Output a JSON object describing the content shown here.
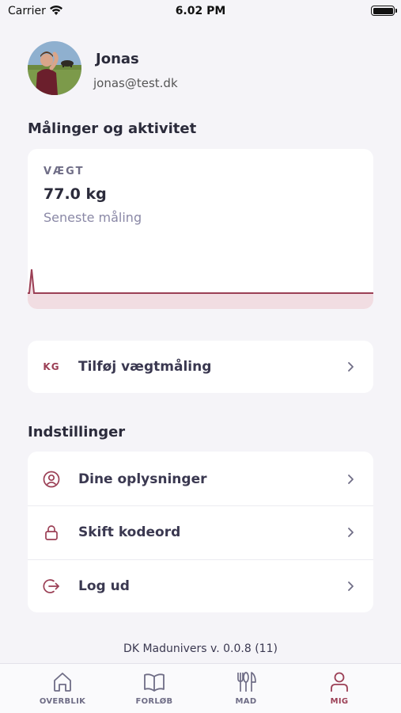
{
  "status_bar": {
    "carrier": "Carrier",
    "time": "6.02 PM"
  },
  "profile": {
    "name": "Jonas",
    "email": "jonas@test.dk"
  },
  "measurements": {
    "section_title": "Målinger og aktivitet",
    "metric_label": "VÆGT",
    "metric_value": "77.0 kg",
    "metric_sub": "Seneste måling"
  },
  "add_weight": {
    "icon_text": "KG",
    "label": "Tilføj vægtmåling"
  },
  "settings": {
    "section_title": "Indstillinger",
    "items": [
      {
        "label": "Dine oplysninger",
        "icon": "user-circle-icon"
      },
      {
        "label": "Skift kodeord",
        "icon": "lock-icon"
      },
      {
        "label": "Log ud",
        "icon": "logout-icon"
      }
    ]
  },
  "version": "DK Madunivers v. 0.0.8 (11)",
  "tabs": [
    {
      "label": "OVERBLIK",
      "icon": "home-icon"
    },
    {
      "label": "FORLØB",
      "icon": "book-icon"
    },
    {
      "label": "MAD",
      "icon": "utensils-icon"
    },
    {
      "label": "MIG",
      "icon": "person-icon",
      "active": true
    }
  ],
  "colors": {
    "accent": "#9b3f55",
    "background": "#f5f4f8",
    "muted": "#6f6d86"
  }
}
